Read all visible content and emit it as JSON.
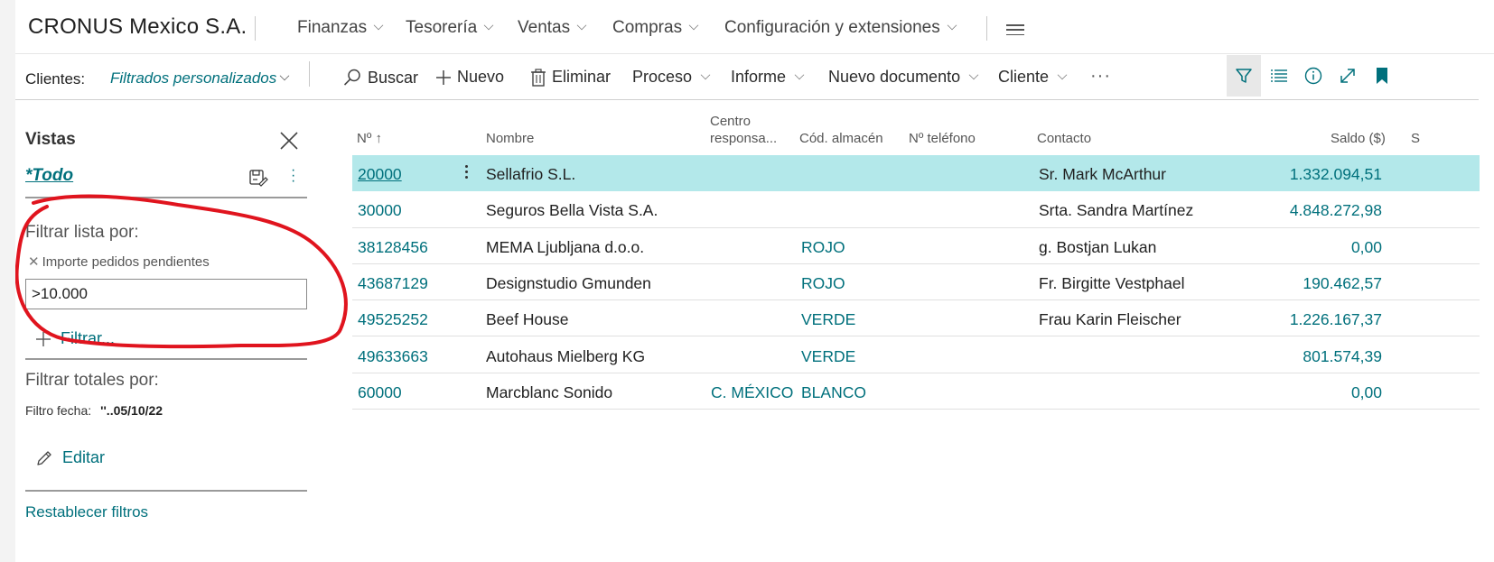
{
  "topnav": {
    "company": "CRONUS Mexico S.A.",
    "menus": [
      "Finanzas",
      "Tesorería",
      "Ventas",
      "Compras",
      "Configuración y extensiones"
    ]
  },
  "actionbar": {
    "clientes_label": "Clientes:",
    "filter_view": "Filtrados personalizados",
    "actions": {
      "buscar": "Buscar",
      "nuevo": "Nuevo",
      "eliminar": "Eliminar",
      "proceso": "Proceso",
      "informe": "Informe",
      "nuevo_documento": "Nuevo documento",
      "cliente": "Cliente",
      "more": "···"
    }
  },
  "pane": {
    "title": "Vistas",
    "current_view": "*Todo",
    "filtrar_lista": "Filtrar lista por:",
    "filter_field": "Importe pedidos pendientes",
    "filter_value": ">10.000",
    "add_filter": "Filtrar...",
    "filtrar_totales": "Filtrar totales por:",
    "fecha_label": "Filtro fecha:",
    "fecha_value": "''..05/10/22",
    "editar": "Editar",
    "reset": "Restablecer filtros"
  },
  "table": {
    "headers": {
      "no": "Nº ↑",
      "nombre": "Nombre",
      "centro_1": "Centro",
      "centro_2": "responsa...",
      "almacen": "Cód. almacén",
      "telefono": "Nº teléfono",
      "contacto": "Contacto",
      "saldo": "Saldo ($)",
      "next": "S"
    },
    "rows": [
      {
        "no": "20000",
        "nombre": "Sellafrio S.L.",
        "centro": "",
        "almacen": "",
        "telefono": "",
        "contacto": "Sr. Mark McArthur",
        "saldo": "1.332.094,51"
      },
      {
        "no": "30000",
        "nombre": "Seguros Bella Vista S.A.",
        "centro": "",
        "almacen": "",
        "telefono": "",
        "contacto": "Srta. Sandra Martínez",
        "saldo": "4.848.272,98"
      },
      {
        "no": "38128456",
        "nombre": "MEMA Ljubljana d.o.o.",
        "centro": "",
        "almacen": "ROJO",
        "telefono": "",
        "contacto": "g. Bostjan Lukan",
        "saldo": "0,00"
      },
      {
        "no": "43687129",
        "nombre": "Designstudio Gmunden",
        "centro": "",
        "almacen": "ROJO",
        "telefono": "",
        "contacto": "Fr. Birgitte Vestphael",
        "saldo": "190.462,57"
      },
      {
        "no": "49525252",
        "nombre": "Beef House",
        "centro": "",
        "almacen": "VERDE",
        "telefono": "",
        "contacto": "Frau Karin Fleischer",
        "saldo": "1.226.167,37"
      },
      {
        "no": "49633663",
        "nombre": "Autohaus Mielberg KG",
        "centro": "",
        "almacen": "VERDE",
        "telefono": "",
        "contacto": "",
        "saldo": "801.574,39"
      },
      {
        "no": "60000",
        "nombre": "Marcblanc Sonido",
        "centro": "C. MÉXICO",
        "almacen": "BLANCO",
        "telefono": "",
        "contacto": "",
        "saldo": "0,00"
      }
    ]
  },
  "colors": {
    "accent": "#00707c",
    "selected_row": "#b3e8ea",
    "annotation": "#e0141e"
  }
}
